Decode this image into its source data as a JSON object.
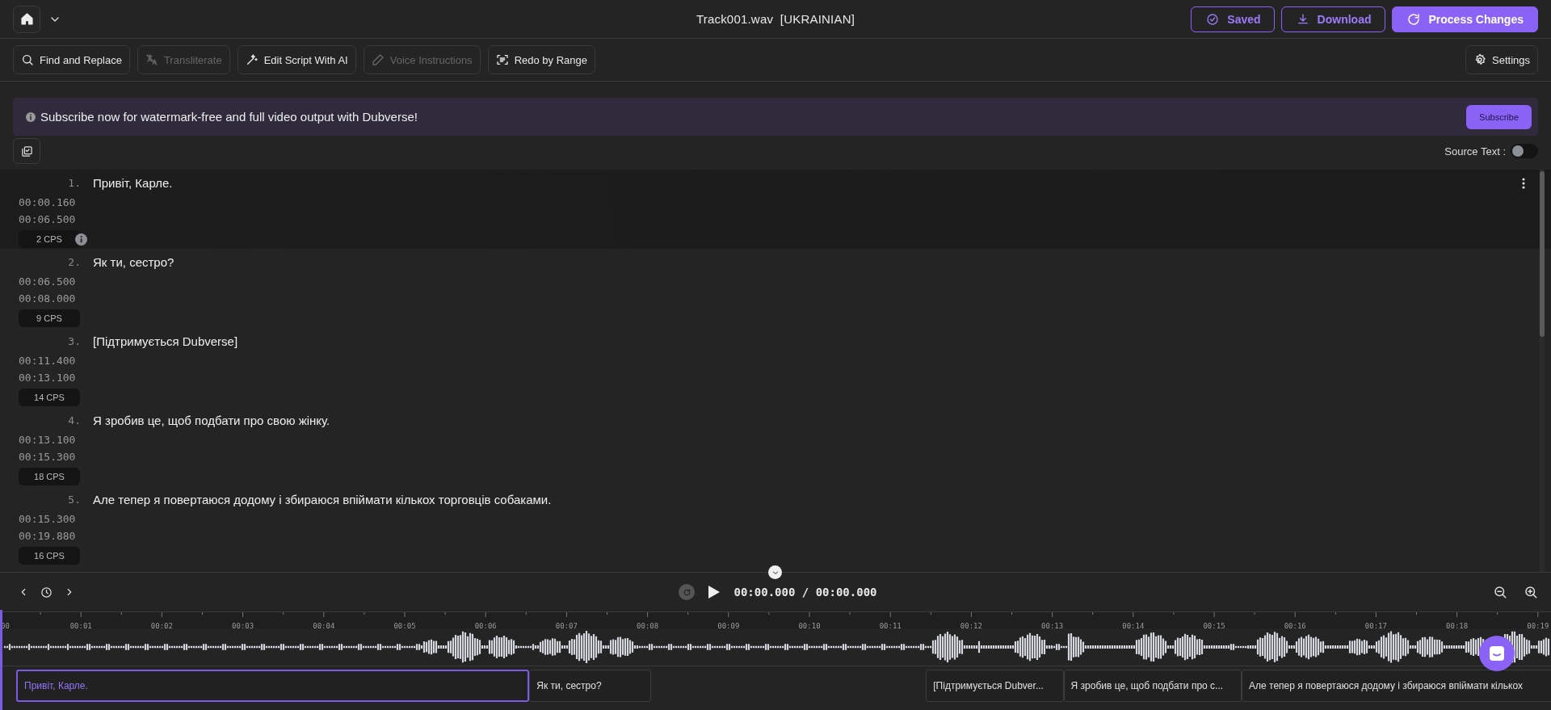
{
  "top_bar": {
    "title": "Track001.wav  [UKRAINIAN]",
    "actions": [
      {
        "label": "Saved",
        "kind": "outline"
      },
      {
        "label": "Download",
        "kind": "outline"
      },
      {
        "label": "Process Changes",
        "kind": "primary"
      }
    ]
  },
  "toolbar": {
    "tools": [
      {
        "label": "Find and Replace",
        "disabled": false
      },
      {
        "label": "Transliterate",
        "disabled": true
      },
      {
        "label": "Edit Script With AI",
        "disabled": false
      },
      {
        "label": "Voice Instructions",
        "disabled": true
      },
      {
        "label": "Redo by Range",
        "disabled": false
      }
    ],
    "settings": "Settings"
  },
  "banner": {
    "message": "Subscribe now for watermark-free and full video output with Dubverse!",
    "button": "Subscribe"
  },
  "source_text": {
    "label": "Source Text :",
    "on": false
  },
  "segments": [
    {
      "number": "1.",
      "text": "Привіт, Карле.",
      "start": "00:00.160",
      "end": "00:06.500",
      "cps": "2 CPS",
      "selected": true
    },
    {
      "number": "2.",
      "text": "Як ти, сестро?",
      "start": "00:06.500",
      "end": "00:08.000",
      "cps": "9 CPS",
      "selected": false
    },
    {
      "number": "3.",
      "text": "[Підтримується Dubverse]",
      "start": "00:11.400",
      "end": "00:13.100",
      "cps": "14 CPS",
      "selected": false
    },
    {
      "number": "4.",
      "text": "Я зробив це, щоб подбати про свою жінку.",
      "start": "00:13.100",
      "end": "00:15.300",
      "cps": "18 CPS",
      "selected": false
    },
    {
      "number": "5.",
      "text": "Але тепер я повертаюся додому і збираюся впіймати кількох торговців собаками.",
      "start": "00:15.300",
      "end": "00:19.880",
      "cps": "16 CPS",
      "selected": false
    }
  ],
  "player": {
    "time": "00:00.000 / 00:00.000"
  },
  "timeline": {
    "ticks": [
      "00",
      "00:01",
      "00:02",
      "00:03",
      "00:04",
      "00:05",
      "00:06",
      "00:07",
      "00:08",
      "00:09",
      "00:10",
      "00:11",
      "00:12",
      "00:13",
      "00:14",
      "00:15",
      "00:16",
      "00:17",
      "00:18",
      "00:19"
    ],
    "blocks": [
      {
        "text": "Привіт, Карле."
      },
      {
        "text": "Як ти, сестро?"
      },
      {
        "text": "[Підтримується Dubver..."
      },
      {
        "text": "Я зробив це, щоб подбати про с..."
      },
      {
        "text": "Але тепер я повертаюся додому і збираюся впіймати кількох"
      }
    ]
  }
}
